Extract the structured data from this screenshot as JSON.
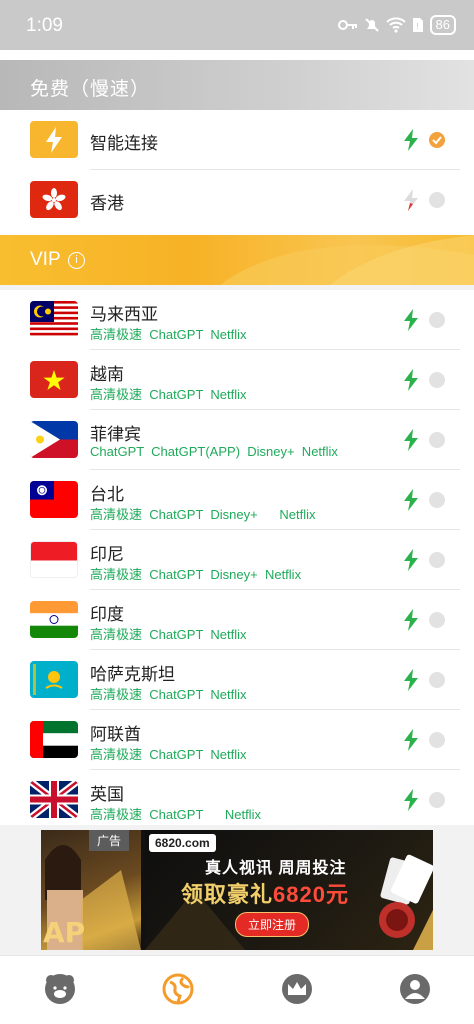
{
  "status": {
    "time": "1:09",
    "battery": "86"
  },
  "free_section": {
    "title": "免费（慢速）",
    "items": [
      {
        "name": "智能连接",
        "icon": "lightning-icon",
        "selected": true
      },
      {
        "name": "香港",
        "flag": "hong-kong-flag",
        "selected": false
      }
    ]
  },
  "vip_section": {
    "title": "VIP",
    "info_icon": "info-icon",
    "items": [
      {
        "name": "马来西亚",
        "tags": "高清极速  ChatGPT  Netflix"
      },
      {
        "name": "越南",
        "tags": "高清极速  ChatGPT  Netflix"
      },
      {
        "name": "菲律宾",
        "tags": "ChatGPT  ChatGPT(APP)  Disney+  Netflix"
      },
      {
        "name": "台北",
        "tags": "高清极速  ChatGPT  Disney+      Netflix"
      },
      {
        "name": "印尼",
        "tags": "高清极速  ChatGPT  Disney+  Netflix"
      },
      {
        "name": "印度",
        "tags": "高清极速  ChatGPT  Netflix"
      },
      {
        "name": "哈萨克斯坦",
        "tags": "高清极速  ChatGPT  Netflix"
      },
      {
        "name": "阿联酋",
        "tags": "高清极速  ChatGPT  Netflix"
      },
      {
        "name": "英国",
        "tags": "高清极速  ChatGPT      Netflix"
      }
    ]
  },
  "ad": {
    "tag": "广告",
    "domain": "6820.com",
    "line1": "真人视讯 周周投注",
    "line2_a": "领取豪礼",
    "line2_b": "6820元",
    "cta": "立即注册"
  },
  "nav": [
    "bear-icon",
    "globe-icon",
    "crown-icon",
    "user-icon"
  ],
  "colors": {
    "accent": "#f3a13a",
    "green": "#1faa5a",
    "vip": "#f8be30"
  }
}
